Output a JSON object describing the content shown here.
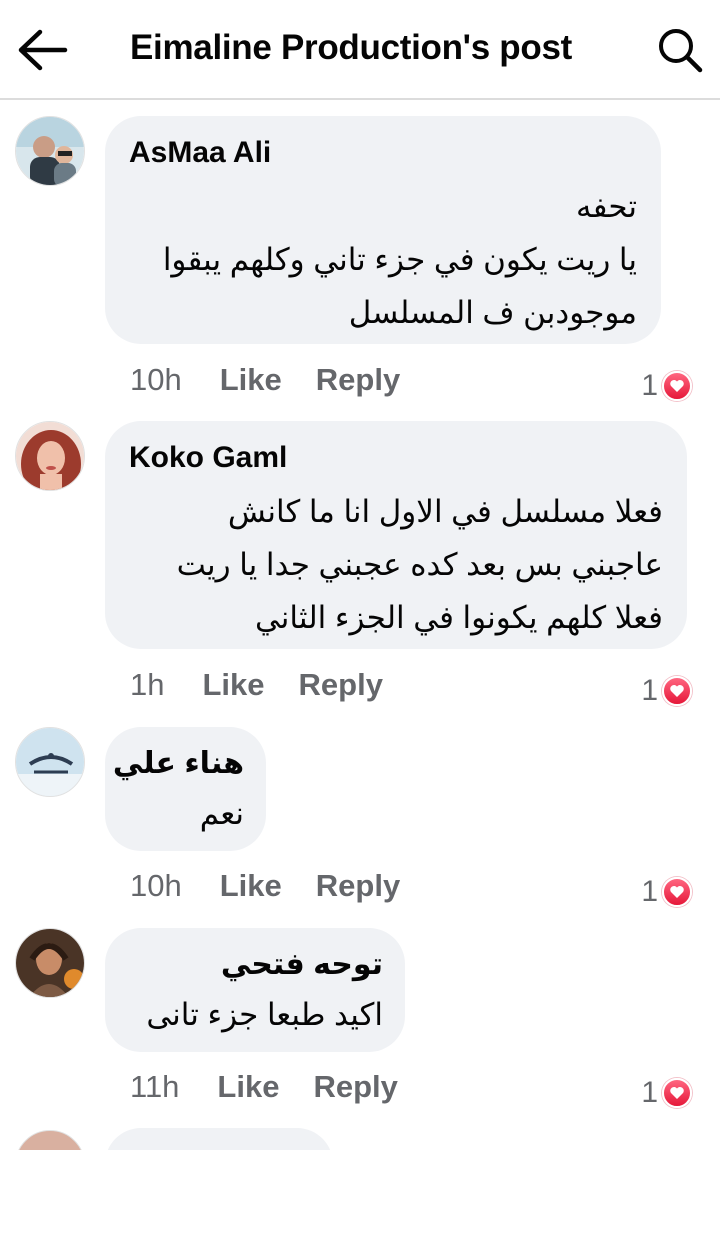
{
  "header": {
    "title": "Eimaline Production's post",
    "back_icon": "arrow-left-icon",
    "search_icon": "search-icon"
  },
  "comments": [
    {
      "author": "AsMaa Ali",
      "lines": [
        "تحفه",
        "يا ريت يكون في جزء تاني وكلهم يبقوا",
        "موجودبن ف المسلسل"
      ],
      "time": "10h",
      "like": "Like",
      "reply": "Reply",
      "reactions": "1"
    },
    {
      "author": "Koko Gaml",
      "lines": [
        "فعلا مسلسل في الاول انا ما كانش",
        "عاجبني بس بعد كده عجبني جدا يا ريت",
        "فعلا كلهم يكونوا في الجزء الثاني"
      ],
      "time": "1h",
      "like": "Like",
      "reply": "Reply",
      "reactions": "1"
    },
    {
      "author": "هناء علي",
      "lines": [
        "نعم"
      ],
      "time": "10h",
      "like": "Like",
      "reply": "Reply",
      "reactions": "1"
    },
    {
      "author": "توحه فتحي",
      "lines": [
        "اكيد طبعا جزء تانى"
      ],
      "time": "11h",
      "like": "Like",
      "reply": "Reply",
      "reactions": "1"
    }
  ],
  "colors": {
    "bubble": "#f0f2f5",
    "meta_text": "#65676b",
    "love_reaction": "#f02849"
  }
}
